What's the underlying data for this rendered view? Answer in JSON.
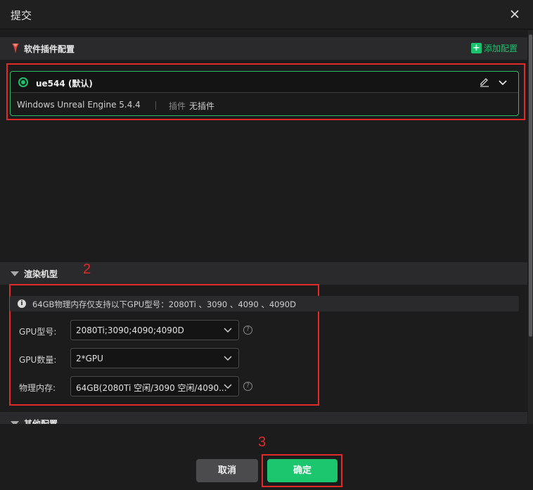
{
  "dialog": {
    "title": "提交"
  },
  "software": {
    "section_title": "软件插件配置",
    "add_label": "添加配置",
    "card": {
      "name": "ue544 (默认)",
      "software": "Windows Unreal Engine 5.4.4",
      "plugin_label": "插件",
      "plugin_value": "无插件"
    }
  },
  "render": {
    "section_title": "渲染机型",
    "info": "64GB物理内存仅支持以下GPU型号：2080Ti 、3090 、4090 、4090D",
    "gpu_model": {
      "label": "GPU型号:",
      "value": "2080Ti;3090;4090;4090D"
    },
    "gpu_count": {
      "label": "GPU数量:",
      "value": "2*GPU"
    },
    "memory": {
      "label": "物理内存:",
      "value": "64GB(2080Ti 空闲/3090 空闲/4090..."
    }
  },
  "other": {
    "section_title": "其他配置"
  },
  "annotations": {
    "a2": "2",
    "a3": "3"
  },
  "footer": {
    "cancel_label": "取消",
    "ok_label": "确定"
  },
  "colors": {
    "accent": "#19c26c",
    "highlight": "#e02a2a",
    "background": "#1e1e1f"
  }
}
